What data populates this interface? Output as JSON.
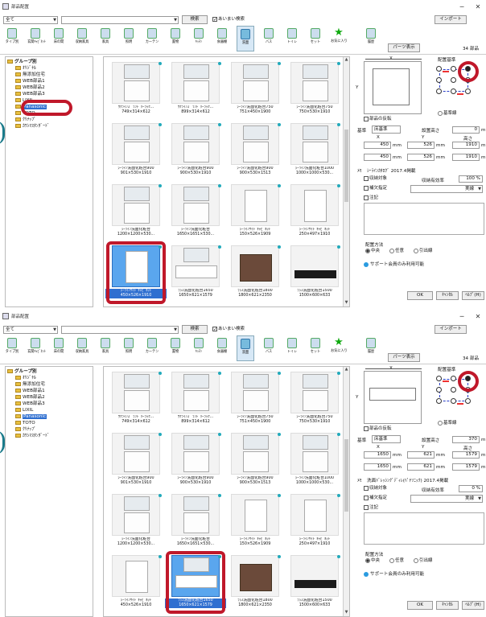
{
  "window": {
    "title": "部品配置"
  },
  "filter": {
    "value": "全て",
    "search_value": "",
    "search_button": "検索",
    "fuzzy_label": "あいまい検索",
    "import_button": "インポート"
  },
  "toolbar": [
    {
      "label": "タイプ別"
    },
    {
      "label": "玄関ｷｬﾋﾞﾈｯﾄ"
    },
    {
      "label": "床の間"
    },
    {
      "label": "収納家具"
    },
    {
      "label": "家具"
    },
    {
      "label": "照明"
    },
    {
      "label": "カーテン"
    },
    {
      "label": "置物"
    },
    {
      "label": "ｷｯﾁﾝ"
    },
    {
      "label": "食器棚"
    },
    {
      "label": "洗面"
    },
    {
      "label": "バス"
    },
    {
      "label": "トイレ"
    },
    {
      "label": "セット"
    },
    {
      "label": "お気に入り"
    },
    {
      "label": "履歴"
    }
  ],
  "panel": {
    "parts_button": "パーツ表示",
    "x_label": "X",
    "y_label": "Y",
    "anchor_label": "配置基準",
    "reverse_label": "部品の反転",
    "ref_line_label": "基準線",
    "base_label": "基準",
    "floor_label": "床基準",
    "height_label": "設置高さ",
    "h_label": "高さ",
    "mm": "mm",
    "memo_label": "ﾒﾓ",
    "storage_label": "収納対象",
    "storage_eff_label": "収納有効率",
    "sync_label": "補欠指定",
    "line_label": "実線",
    "note_label": "注記",
    "method_label": "配置方法",
    "center": "中央",
    "any": "任意",
    "pull": "引出線",
    "support": "サポート会員のみ利用可能",
    "ok": "OK",
    "cancel": "ｷｬﾝｾﾙ",
    "help": "ﾍﾙﾌﾟ(H)"
  },
  "screens": [
    {
      "count_label": "34 部品",
      "tree": [
        {
          "label": "グループ別",
          "level": 0,
          "top": true
        },
        {
          "label": "ｵﾘｼﾞﾅﾙ",
          "level": 1
        },
        {
          "label": "無添加住宅",
          "level": 1
        },
        {
          "label": "WEB部品1",
          "level": 1
        },
        {
          "label": "WEB部品2",
          "level": 1
        },
        {
          "label": "WEB部品3",
          "level": 1
        },
        {
          "label": "LIXIL",
          "level": 1
        },
        {
          "label": "Panasonic",
          "level": 1,
          "selected": true
        },
        {
          "label": "TOTO",
          "level": 1
        },
        {
          "label": "ｸﾘﾅｯﾌﾟ",
          "level": 1
        },
        {
          "label": "ｶﾜｼﾏｽﾀﾝﾀﾞｰﾄﾞ",
          "level": 1
        }
      ],
      "items": [
        {
          "name": "ｳｸﾗｲﾝｽﾞ ﾗﾝﾄﾞﾘｰﾗｯｸ...",
          "size": "749×314×612",
          "shape": "mir"
        },
        {
          "name": "ｳｸﾗｲﾝｽﾞ ﾗﾝﾄﾞﾘｰﾗｯｸ...",
          "size": "899×314×612",
          "shape": "mir"
        },
        {
          "name": "ｼｰﾗｲﾝ洗面化粧台750",
          "size": "751×450×1900",
          "shape": "mir"
        },
        {
          "name": "ｼｰﾗｲﾝ洗面化粧台750",
          "size": "750×530×1910",
          "shape": "mir"
        },
        {
          "name": "ｼｰﾗｲﾝ洗面化粧台900",
          "size": "901×530×1910",
          "shape": "van"
        },
        {
          "name": "ｼｰﾗｲﾝ洗面化粧台900",
          "size": "900×530×1910",
          "shape": "van"
        },
        {
          "name": "ｼｰﾗｲﾝ洗面化粧台900",
          "size": "900×530×1513",
          "shape": "van"
        },
        {
          "name": "ｼｰﾗｲﾝ洗面化粧台1000",
          "size": "1000×1000×530...",
          "shape": "van"
        },
        {
          "name": "ｼｰﾗｲﾝ洗面化粧台",
          "size": "1200×1200×530...",
          "shape": "van"
        },
        {
          "name": "ｼｰﾗｲﾝ洗面化粧台",
          "size": "1650×1651×530...",
          "shape": "van"
        },
        {
          "name": "ｼｰﾗｲﾝｻｲﾄﾞｷｬﾋﾞﾈｯﾄ",
          "size": "150×526×1909",
          "shape": "tall"
        },
        {
          "name": "ｼｰﾗｲﾝｻｲﾄﾞｷｬﾋﾞﾈｯﾄ",
          "size": "250×497×1910",
          "shape": "tall"
        },
        {
          "name": "ｼｰﾗｲﾝｻｲﾄﾞｷｬﾋﾞﾈｯﾄ",
          "size": "450×526×1910",
          "shape": "tall"
        },
        {
          "name": "ﾗｼｽ洗面化粧台1650",
          "size": "1650×621×1579",
          "shape": "wide"
        },
        {
          "name": "ﾗｼｽ洗面化粧台1800",
          "size": "1800×621×2350",
          "shape": "dark"
        },
        {
          "name": "ﾗｼｽ洗面化粧台1500",
          "size": "1500×600×633",
          "shape": "blk"
        }
      ],
      "selected_item": 12,
      "x_value": "450",
      "y_value": "526",
      "z_value": "1910",
      "x_value2": "450",
      "y_value2": "526",
      "z_value2": "1910",
      "install_height": "0",
      "memo_value": "ｼｰﾗｲﾝｶﾀﾛｸﾞ 2017.4掲載",
      "storage_eff": "100 %"
    },
    {
      "count_label": "34 部品",
      "tree": [
        {
          "label": "グループ別",
          "level": 0,
          "top": true
        },
        {
          "label": "ｵﾘｼﾞﾅﾙ",
          "level": 1
        },
        {
          "label": "無添加住宅",
          "level": 1
        },
        {
          "label": "WEB部品1",
          "level": 1
        },
        {
          "label": "WEB部品2",
          "level": 1
        },
        {
          "label": "WEB部品3",
          "level": 1
        },
        {
          "label": "LIXIL",
          "level": 1
        },
        {
          "label": "Panasonic",
          "level": 1,
          "selected": true
        },
        {
          "label": "TOTO",
          "level": 1
        },
        {
          "label": "ｸﾘﾅｯﾌﾟ",
          "level": 1
        },
        {
          "label": "ｶﾜｼﾏｽﾀﾝﾀﾞｰﾄﾞ",
          "level": 1
        }
      ],
      "items": [
        {
          "name": "ｳｸﾗｲﾝｽﾞ ﾗﾝﾄﾞﾘｰﾗｯｸ...",
          "size": "749×314×612",
          "shape": "mir"
        },
        {
          "name": "ｳｸﾗｲﾝｽﾞ ﾗﾝﾄﾞﾘｰﾗｯｸ...",
          "size": "899×314×612",
          "shape": "mir"
        },
        {
          "name": "ｼｰﾗｲﾝ洗面化粧台750",
          "size": "751×450×1900",
          "shape": "mir"
        },
        {
          "name": "ｼｰﾗｲﾝ洗面化粧台750",
          "size": "750×530×1910",
          "shape": "mir"
        },
        {
          "name": "ｼｰﾗｲﾝ洗面化粧台900",
          "size": "901×530×1910",
          "shape": "van"
        },
        {
          "name": "ｼｰﾗｲﾝ洗面化粧台900",
          "size": "900×530×1910",
          "shape": "van"
        },
        {
          "name": "ｼｰﾗｲﾝ洗面化粧台900",
          "size": "900×530×1513",
          "shape": "van"
        },
        {
          "name": "ｼｰﾗｲﾝ洗面化粧台1000",
          "size": "1000×1000×530...",
          "shape": "van"
        },
        {
          "name": "ｼｰﾗｲﾝ洗面化粧台",
          "size": "1200×1200×530...",
          "shape": "van"
        },
        {
          "name": "ｼｰﾗｲﾝ洗面化粧台",
          "size": "1650×1651×530...",
          "shape": "van"
        },
        {
          "name": "ｼｰﾗｲﾝｻｲﾄﾞｷｬﾋﾞﾈｯﾄ",
          "size": "150×526×1909",
          "shape": "tall"
        },
        {
          "name": "ｼｰﾗｲﾝｻｲﾄﾞｷｬﾋﾞﾈｯﾄ",
          "size": "250×497×1910",
          "shape": "tall"
        },
        {
          "name": "ｼｰﾗｲﾝｻｲﾄﾞｷｬﾋﾞﾈｯﾄ",
          "size": "450×526×1910",
          "shape": "tall"
        },
        {
          "name": "ﾗｼｽ洗面化粧台1650",
          "size": "1650×621×1579",
          "shape": "wide"
        },
        {
          "name": "ﾗｼｽ洗面化粧台1800",
          "size": "1800×621×2350",
          "shape": "dark"
        },
        {
          "name": "ﾗｼｽ洗面化粧台1500",
          "size": "1500×600×633",
          "shape": "blk"
        }
      ],
      "selected_item": 13,
      "x_value": "1650",
      "y_value": "621",
      "z_value": "1579",
      "x_value2": "1650",
      "y_value2": "621",
      "z_value2": "1579",
      "install_height": "370",
      "memo_value": "洗面ﾄﾞﾚｯｼﾝｸﾞﾃﾞｨﾚ(ﾊﾟﾅｿﾆｯｸ) 2017.4掲載",
      "storage_eff": "0 %"
    }
  ]
}
